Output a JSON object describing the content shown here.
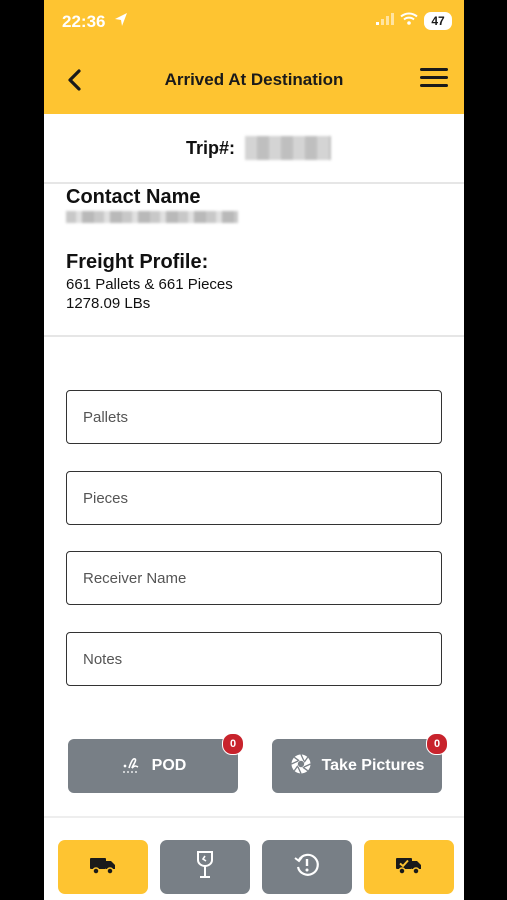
{
  "status_bar": {
    "time": "22:36",
    "battery": "47"
  },
  "header": {
    "title": "Arrived At Destination"
  },
  "trip": {
    "label": "Trip#:"
  },
  "contact": {
    "title": "Contact Name"
  },
  "freight": {
    "title": "Freight Profile:",
    "line1": "661  Pallets & 661  Pieces",
    "line2": "1278.09 LBs"
  },
  "form": {
    "pallets_placeholder": "Pallets",
    "pieces_placeholder": "Pieces",
    "receiver_placeholder": "Receiver Name",
    "notes_placeholder": "Notes"
  },
  "actions": {
    "pod_label": "POD",
    "pod_count": "0",
    "pictures_label": "Take Pictures",
    "pictures_count": "0"
  },
  "tabs": [
    {
      "icon": "truck-icon"
    },
    {
      "icon": "fragile-package-icon"
    },
    {
      "icon": "history-icon"
    },
    {
      "icon": "truck-check-icon"
    }
  ],
  "colors": {
    "accent": "#FEC431",
    "button_grey": "#787F86",
    "badge_red": "#C8232C"
  }
}
